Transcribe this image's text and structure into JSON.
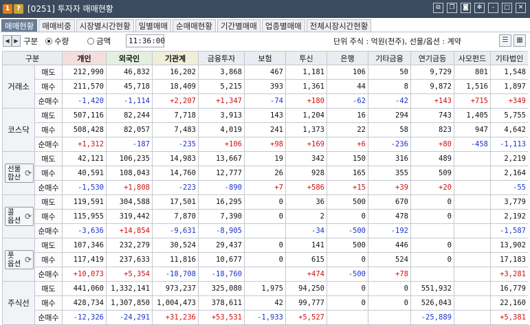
{
  "window": {
    "badge": "1",
    "help": "?",
    "title": "[0251] 투자자 매매현황"
  },
  "tabs": [
    {
      "label": "매매현황",
      "active": true
    },
    {
      "label": "매매비중",
      "active": false
    },
    {
      "label": "시장별시간현황",
      "active": false
    },
    {
      "label": "일별매매",
      "active": false
    },
    {
      "label": "순매매현황",
      "active": false
    },
    {
      "label": "기간별매매",
      "active": false
    },
    {
      "label": "업종별매매",
      "active": false
    },
    {
      "label": "전체시장시간현황",
      "active": false
    }
  ],
  "toolbar": {
    "gubun_label": "구분",
    "radio_quantity": "수량",
    "radio_amount": "금액",
    "selected_radio": "수량",
    "time": "11:36:00",
    "unit_text": "단위 주식 : 억원(천주), 선물/옵션 : 계약"
  },
  "colors": {
    "positive": "#d01010",
    "negative": "#1a33d0",
    "titlebar": "#3b4a5e",
    "active_tab": "#6c7d96"
  },
  "table": {
    "corner_label": "구분",
    "columns": [
      "개인",
      "외국인",
      "기관계",
      "금융투자",
      "보험",
      "투신",
      "은행",
      "기타금융",
      "연기금등",
      "사모펀드",
      "기타법인"
    ],
    "groups": [
      {
        "name": "거래소",
        "button": false,
        "rows": [
          {
            "label": "매도",
            "values": [
              "212,990",
              "46,832",
              "16,202",
              "3,868",
              "467",
              "1,181",
              "106",
              "50",
              "9,729",
              "801",
              "1,548"
            ]
          },
          {
            "label": "매수",
            "values": [
              "211,570",
              "45,718",
              "18,409",
              "5,215",
              "393",
              "1,361",
              "44",
              "8",
              "9,872",
              "1,516",
              "1,897"
            ]
          },
          {
            "label": "순매수",
            "values": [
              "-1,420",
              "-1,114",
              "+2,207",
              "+1,347",
              "-74",
              "+180",
              "-62",
              "-42",
              "+143",
              "+715",
              "+349"
            ]
          }
        ]
      },
      {
        "name": "코스닥",
        "button": false,
        "rows": [
          {
            "label": "매도",
            "values": [
              "507,116",
              "82,244",
              "7,718",
              "3,913",
              "143",
              "1,204",
              "16",
              "294",
              "743",
              "1,405",
              "5,755"
            ]
          },
          {
            "label": "매수",
            "values": [
              "508,428",
              "82,057",
              "7,483",
              "4,019",
              "241",
              "1,373",
              "22",
              "58",
              "823",
              "947",
              "4,642"
            ]
          },
          {
            "label": "순매수",
            "values": [
              "+1,312",
              "-187",
              "-235",
              "+106",
              "+98",
              "+169",
              "+6",
              "-236",
              "+80",
              "-458",
              "-1,113"
            ]
          }
        ]
      },
      {
        "name": "선물합산",
        "button": true,
        "btn_line1": "선물",
        "btn_line2": "합산",
        "rows": [
          {
            "label": "매도",
            "values": [
              "42,121",
              "106,235",
              "14,983",
              "13,667",
              "19",
              "342",
              "150",
              "316",
              "489",
              "",
              "2,219"
            ]
          },
          {
            "label": "매수",
            "values": [
              "40,591",
              "108,043",
              "14,760",
              "12,777",
              "26",
              "928",
              "165",
              "355",
              "509",
              "",
              "2,164"
            ]
          },
          {
            "label": "순매수",
            "values": [
              "-1,530",
              "+1,808",
              "-223",
              "-890",
              "+7",
              "+586",
              "+15",
              "+39",
              "+20",
              "",
              "-55"
            ]
          }
        ]
      },
      {
        "name": "콜옵션",
        "button": true,
        "btn_line1": "콜",
        "btn_line2": "옵션",
        "rows": [
          {
            "label": "매도",
            "values": [
              "119,591",
              "304,588",
              "17,501",
              "16,295",
              "0",
              "36",
              "500",
              "670",
              "0",
              "",
              "3,779"
            ]
          },
          {
            "label": "매수",
            "values": [
              "115,955",
              "319,442",
              "7,870",
              "7,390",
              "0",
              "2",
              "0",
              "478",
              "0",
              "",
              "2,192"
            ]
          },
          {
            "label": "순매수",
            "values": [
              "-3,636",
              "+14,854",
              "-9,631",
              "-8,905",
              "",
              "-34",
              "-500",
              "-192",
              "",
              "",
              "-1,587"
            ]
          }
        ]
      },
      {
        "name": "풋옵션",
        "button": true,
        "btn_line1": "풋",
        "btn_line2": "옵션",
        "rows": [
          {
            "label": "매도",
            "values": [
              "107,346",
              "232,279",
              "30,524",
              "29,437",
              "0",
              "141",
              "500",
              "446",
              "0",
              "",
              "13,902"
            ]
          },
          {
            "label": "매수",
            "values": [
              "117,419",
              "237,633",
              "11,816",
              "10,677",
              "0",
              "615",
              "0",
              "524",
              "0",
              "",
              "17,183"
            ]
          },
          {
            "label": "순매수",
            "values": [
              "+10,073",
              "+5,354",
              "-18,708",
              "-18,760",
              "",
              "+474",
              "-500",
              "+78",
              "",
              "",
              "+3,281"
            ]
          }
        ]
      },
      {
        "name": "주식선",
        "button": false,
        "rows": [
          {
            "label": "매도",
            "values": [
              "441,060",
              "1,332,141",
              "973,237",
              "325,080",
              "1,975",
              "94,250",
              "0",
              "0",
              "551,932",
              "",
              "16,779"
            ]
          },
          {
            "label": "매수",
            "values": [
              "428,734",
              "1,307,850",
              "1,004,473",
              "378,611",
              "42",
              "99,777",
              "0",
              "0",
              "526,043",
              "",
              "22,160"
            ]
          },
          {
            "label": "순매수",
            "values": [
              "-12,326",
              "-24,291",
              "+31,236",
              "+53,531",
              "-1,933",
              "+5,527",
              "",
              "",
              "-25,889",
              "",
              "+5,381"
            ]
          }
        ]
      }
    ]
  }
}
